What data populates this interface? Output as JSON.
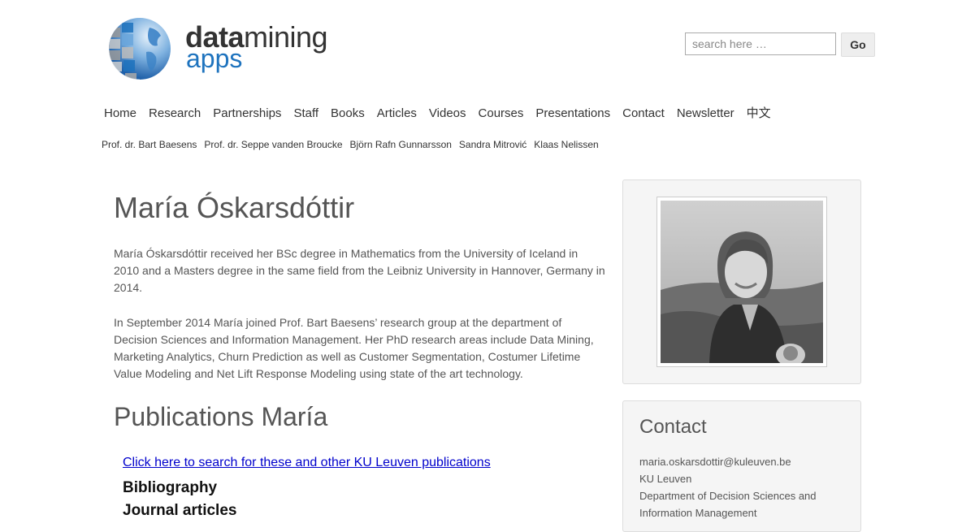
{
  "logo": {
    "text_bold": "data",
    "text_regular": "mining",
    "text_second": "apps",
    "icon": "globe-icon"
  },
  "search": {
    "placeholder": "search here …",
    "button_label": "Go"
  },
  "main_nav": [
    "Home",
    "Research",
    "Partnerships",
    "Staff",
    "Books",
    "Articles",
    "Videos",
    "Courses",
    "Presentations",
    "Contact",
    "Newsletter",
    "中文"
  ],
  "sub_nav": [
    "Prof. dr. Bart Baesens",
    "Prof. dr. Seppe vanden Broucke",
    "Björn Rafn Gunnarsson",
    "Sandra Mitrović",
    "Klaas Nelissen"
  ],
  "profile": {
    "name": "María Óskarsdóttir",
    "bio_1": "María Óskarsdóttir received her BSc degree in Mathematics from the University of Iceland in 2010 and a Masters degree in the same field from the Leibniz University in Hannover, Germany in 2014.",
    "bio_2": "In September 2014 María joined Prof. Bart Baesens’ research group at the department of Decision Sciences and Information Management. Her PhD research areas include Data Mining, Marketing Analytics, Churn Prediction as well as Customer Segmentation, Costumer Lifetime Value Modeling and Net Lift Response Modeling using state of the art technology."
  },
  "publications": {
    "heading": "Publications María",
    "link_text": "Click here to search for these and other KU Leuven publications",
    "bibliography_label": "Bibliography",
    "journal_label": "Journal articles"
  },
  "contact": {
    "heading": "Contact",
    "email": "maria.oskarsdottir@kuleuven.be",
    "institution": "KU Leuven",
    "department": "Department of Decision Sciences and Information Management"
  },
  "colors": {
    "brand_blue": "#1e73be",
    "link": "#0000cc",
    "sidebar_bg": "#f5f5f5"
  }
}
